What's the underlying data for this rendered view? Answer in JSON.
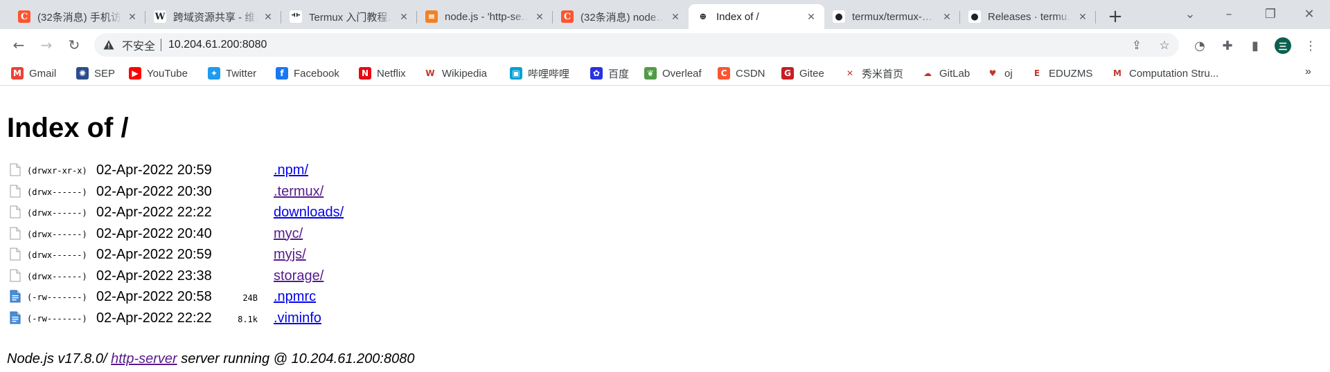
{
  "tabs": [
    {
      "title": "(32条消息) 手机访问…",
      "favicon": "csdn-icon",
      "color": "#fc5531",
      "glyph": "C"
    },
    {
      "title": "跨域资源共享 - 维基…",
      "favicon": "wikipedia-icon",
      "color": "#ffffff",
      "glyph": "W"
    },
    {
      "title": "Termux 入门教程…",
      "favicon": "termux-icon",
      "color": "#ffffff",
      "glyph": "⻀"
    },
    {
      "title": "node.js - 'http-se…",
      "favicon": "stackoverflow-icon",
      "color": "#f48024",
      "glyph": "≡"
    },
    {
      "title": "(32条消息) node…",
      "favicon": "csdn-icon",
      "color": "#fc5531",
      "glyph": "C"
    },
    {
      "title": "Index of /",
      "favicon": "globe-icon",
      "color": "#ffffff",
      "glyph": "⊕",
      "active": true
    },
    {
      "title": "termux/termux-…",
      "favicon": "github-icon",
      "color": "#ffffff",
      "glyph": "●"
    },
    {
      "title": "Releases · termu…",
      "favicon": "github-icon",
      "color": "#ffffff",
      "glyph": "●"
    }
  ],
  "address": {
    "security_label": "不安全",
    "url": "10.204.61.200:8080"
  },
  "profile": {
    "initial": "三"
  },
  "bookmarks": [
    {
      "label": "Gmail",
      "icon": "gmail-icon",
      "color": "#ea4335",
      "glyph": "M"
    },
    {
      "label": "SEP",
      "icon": "sep-icon",
      "color": "#2c4c8c",
      "glyph": "✺"
    },
    {
      "label": "YouTube",
      "icon": "youtube-icon",
      "color": "#ff0000",
      "glyph": "▶"
    },
    {
      "label": "Twitter",
      "icon": "twitter-icon",
      "color": "#1d9bf0",
      "glyph": "✦"
    },
    {
      "label": "Facebook",
      "icon": "facebook-icon",
      "color": "#1877f2",
      "glyph": "f"
    },
    {
      "label": "Netflix",
      "icon": "netflix-icon",
      "color": "#e50914",
      "glyph": "N"
    },
    {
      "label": "Wikipedia",
      "icon": "wikipedia-icon",
      "color": "#ffffff",
      "glyph": "W"
    },
    {
      "label": "哔哩哔哩",
      "icon": "bilibili-icon",
      "color": "#00a1d6",
      "glyph": "▣"
    },
    {
      "label": "百度",
      "icon": "baidu-icon",
      "color": "#2932e1",
      "glyph": "✿"
    },
    {
      "label": "Overleaf",
      "icon": "overleaf-icon",
      "color": "#4f9c45",
      "glyph": "❦"
    },
    {
      "label": "CSDN",
      "icon": "csdn-icon",
      "color": "#fc5531",
      "glyph": "C"
    },
    {
      "label": "Gitee",
      "icon": "gitee-icon",
      "color": "#c71d23",
      "glyph": "G"
    },
    {
      "label": "秀米首页",
      "icon": "xiumi-icon",
      "color": "#ffffff",
      "glyph": "✕"
    },
    {
      "label": "GitLab",
      "icon": "gitlab-cloud-icon",
      "color": "#ffffff",
      "glyph": "☁"
    },
    {
      "label": "oj",
      "icon": "oj-icon",
      "color": "#ffffff",
      "glyph": "♥"
    },
    {
      "label": "EDUZMS",
      "icon": "eduzms-icon",
      "color": "#ffffff",
      "glyph": "E"
    },
    {
      "label": "Computation Stru...",
      "icon": "mit-icon",
      "color": "#ffffff",
      "glyph": "M"
    }
  ],
  "bookmarks_more": "»",
  "listing": {
    "heading": "Index of /",
    "entries": [
      {
        "perm": "(drwxr-xr-x)",
        "date": "02-Apr-2022 20:59",
        "size": "",
        "name": ".npm/",
        "type": "dir",
        "visited": false
      },
      {
        "perm": "(drwx------)",
        "date": "02-Apr-2022 20:30",
        "size": "",
        "name": ".termux/",
        "type": "dir",
        "visited": true
      },
      {
        "perm": "(drwx------)",
        "date": "02-Apr-2022 22:22",
        "size": "",
        "name": "downloads/",
        "type": "dir",
        "visited": false
      },
      {
        "perm": "(drwx------)",
        "date": "02-Apr-2022 20:40",
        "size": "",
        "name": "myc/",
        "type": "dir",
        "visited": true
      },
      {
        "perm": "(drwx------)",
        "date": "02-Apr-2022 20:59",
        "size": "",
        "name": "myjs/",
        "type": "dir",
        "visited": true
      },
      {
        "perm": "(drwx------)",
        "date": "02-Apr-2022 23:38",
        "size": "",
        "name": "storage/",
        "type": "dir",
        "visited": true
      },
      {
        "perm": "(-rw-------)",
        "date": "02-Apr-2022 20:58",
        "size": "24B",
        "name": ".npmrc",
        "type": "file",
        "visited": false
      },
      {
        "perm": "(-rw-------)",
        "date": "02-Apr-2022 22:22",
        "size": "8.1k",
        "name": ".viminfo",
        "type": "file",
        "visited": false
      }
    ],
    "footer_prefix": "Node.js v17.8.0/ ",
    "footer_link": "http-server",
    "footer_suffix": " server running @ 10.204.61.200:8080"
  }
}
